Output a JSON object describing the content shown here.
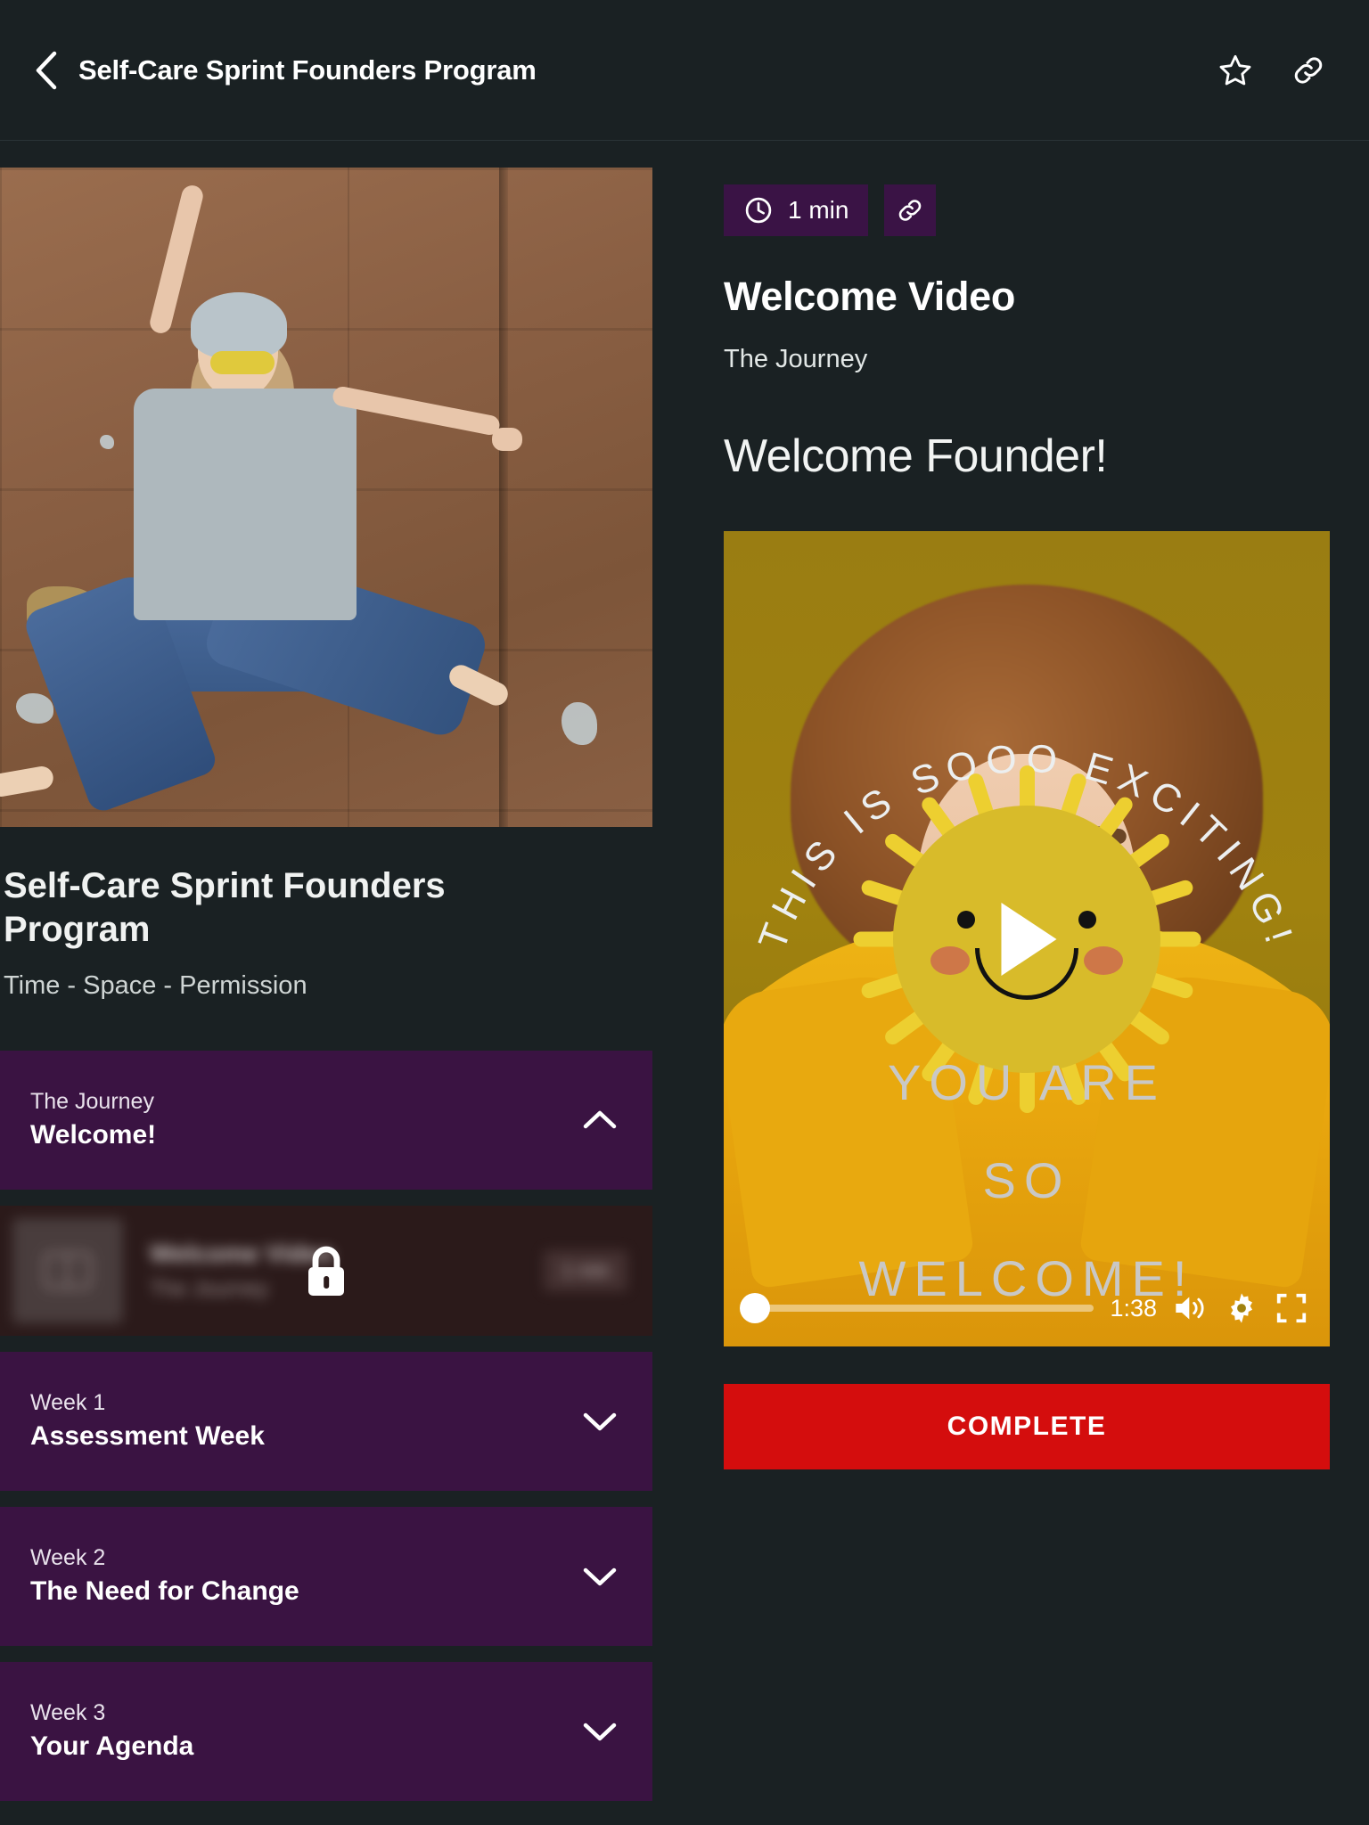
{
  "topbar": {
    "back_icon": "chevron-left-icon",
    "title": "Self-Care Sprint Founders Program",
    "favorite_icon": "star-icon",
    "share_icon": "link-icon"
  },
  "course": {
    "title": "Self-Care Sprint Founders Program",
    "subtitle": "Time - Space - Permission",
    "hero_image_alt": "Woman in grey beanie and yellow sunglasses jumping in front of a brown wooden wall"
  },
  "curriculum": [
    {
      "eyebrow": "The Journey",
      "title": "Welcome!",
      "expanded": true,
      "chevron": "chevron-up-icon"
    },
    {
      "eyebrow": "Week 1",
      "title": "Assessment Week",
      "expanded": false,
      "chevron": "chevron-down-icon"
    },
    {
      "eyebrow": "Week 2",
      "title": "The Need for Change",
      "expanded": false,
      "chevron": "chevron-down-icon"
    },
    {
      "eyebrow": "Week 3",
      "title": "Your Agenda",
      "expanded": false,
      "chevron": "chevron-down-icon"
    }
  ],
  "locked_lesson": {
    "name": "Welcome Video",
    "section": "The Journey",
    "duration": "1 min",
    "lock_icon": "lock-icon",
    "thumb_icon": "book-icon",
    "state": "locked-blurred"
  },
  "lesson": {
    "duration": "1 min",
    "clock_icon": "clock-icon",
    "link_icon": "link-icon",
    "title": "Welcome Video",
    "section": "The Journey",
    "content_heading": "Welcome Founder!"
  },
  "video": {
    "arc_text": "THIS IS SOOO EXCITING!",
    "line_1": "YOU ARE",
    "line_2": "SO",
    "line_3": "WELCOME!",
    "play_icon": "play-icon",
    "time": "1:38",
    "volume_icon": "volume-high-icon",
    "settings_icon": "gear-icon",
    "fullscreen_icon": "fullscreen-icon",
    "progress_percent": 0
  },
  "actions": {
    "complete_label": "COMPLETE"
  },
  "colors": {
    "background": "#1a2123",
    "accent_purple": "#3a1342",
    "chip_purple": "#3a1345",
    "complete_red": "#d40d0d",
    "video_yellow": "#a0820f",
    "text_primary": "#ffffff",
    "text_secondary": "#cfd5d4"
  }
}
